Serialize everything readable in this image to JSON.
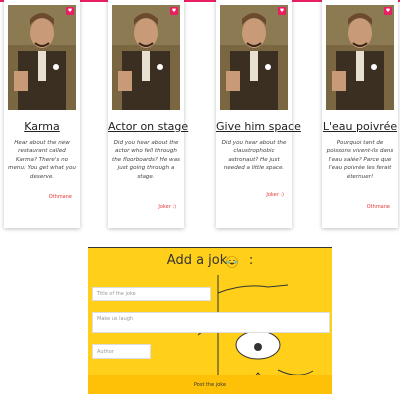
{
  "cards": [
    {
      "title": "Karma",
      "text": "Hear about the new restaurant called Karma? There's no menu: You get what you deserve.",
      "author": "Othmane",
      "heart_icon": "heart-icon",
      "image": "laughing-man-photo"
    },
    {
      "title": "Actor on stage",
      "text": "Did you hear about the actor who fell through the floorboards? He was just going through a stage.",
      "author": "Joker :)",
      "heart_icon": "heart-icon",
      "image": "laughing-man-photo"
    },
    {
      "title": "Give him space",
      "text": "Did you hear about the claustrophobic astronaut? He just needed a little space.",
      "author": "Joker :)",
      "heart_icon": "heart-icon",
      "image": "laughing-man-photo"
    },
    {
      "title": "L'eau poivrée",
      "text": "Pourquoi tant de poissons vivent-ils dans l'eau salée? Parce que l'eau poivrée les ferait éternuer!",
      "author": "Othmane",
      "heart_icon": "heart-icon",
      "image": "laughing-man-photo"
    }
  ],
  "form": {
    "title": "Add a joke",
    "title_suffix": ":",
    "emoji": "laughing-emoji-icon",
    "title_placeholder": "Title of the joke",
    "text_placeholder": "Make us laugh",
    "author_placeholder": "Author",
    "submit_label": "Post the joke"
  },
  "colors": {
    "accent": "#e91e63",
    "author": "#e53935",
    "form_background": "#ffcf1a",
    "submit_background": "#ffc107"
  }
}
